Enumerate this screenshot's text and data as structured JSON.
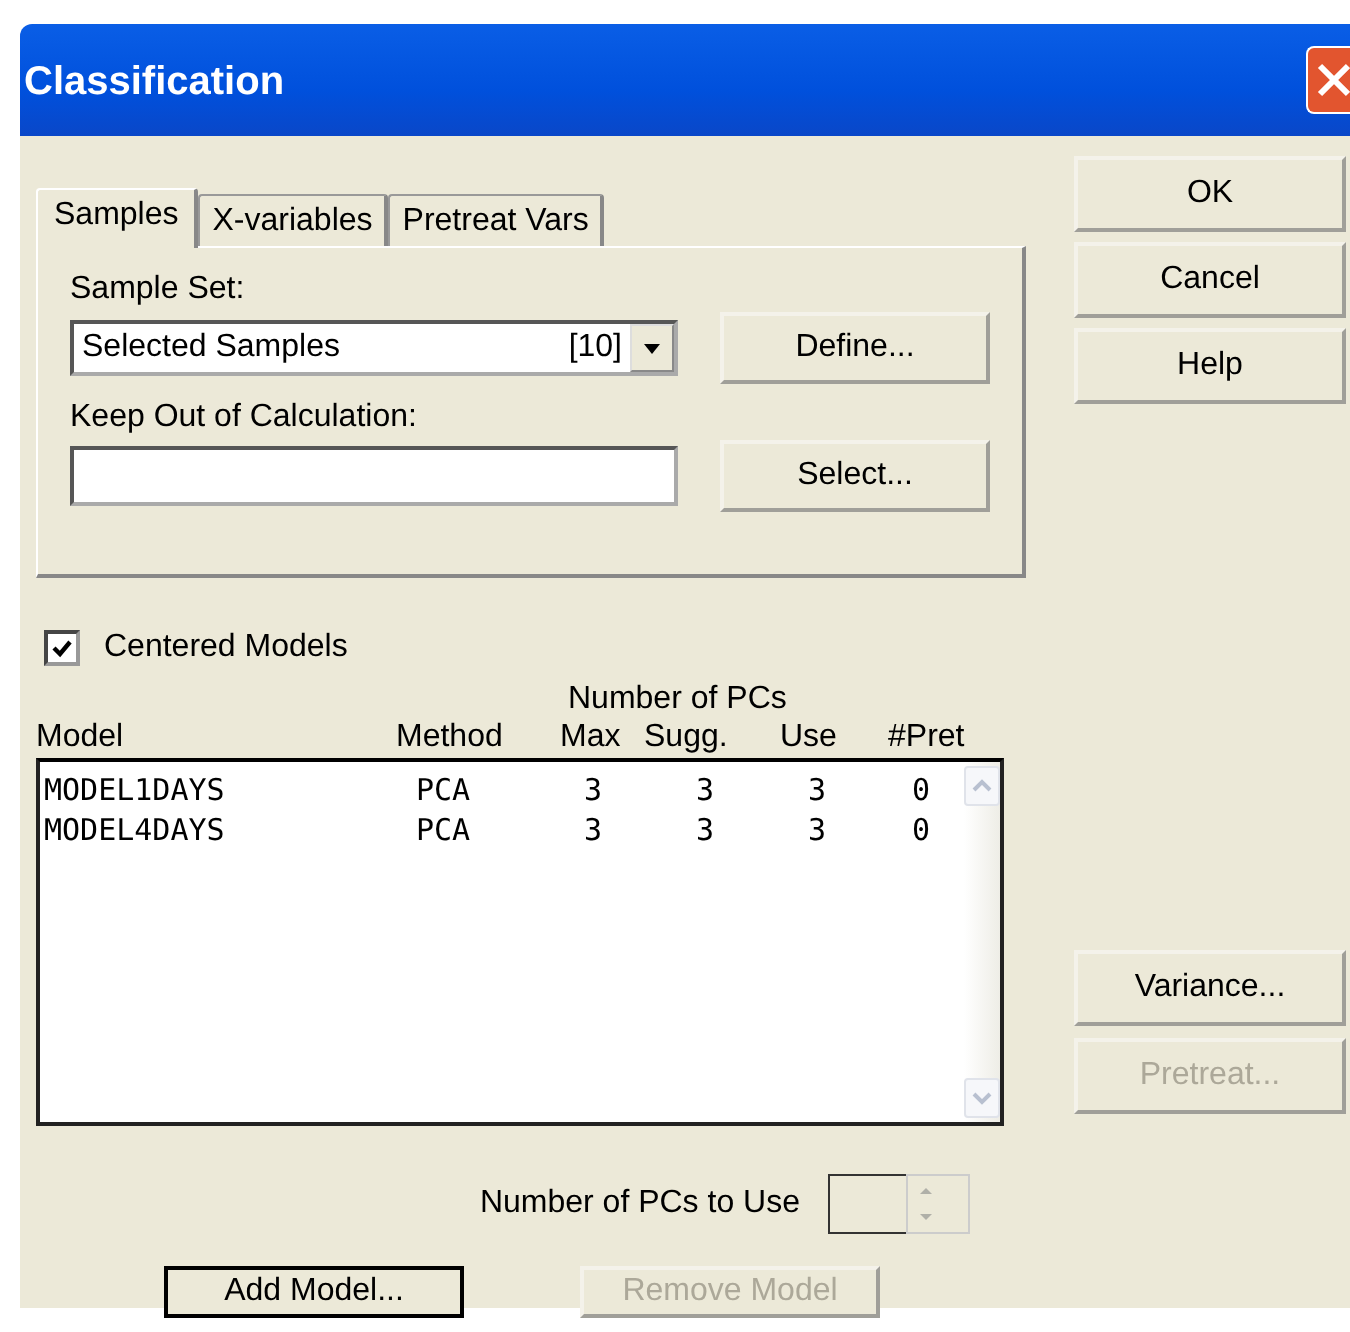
{
  "window": {
    "title": "Classification"
  },
  "tabs": [
    {
      "label": "Samples",
      "selected": true
    },
    {
      "label": "X-variables",
      "selected": false
    },
    {
      "label": "Pretreat Vars",
      "selected": false
    }
  ],
  "sample_set": {
    "label": "Sample Set:",
    "value": "Selected Samples",
    "count": "[10]"
  },
  "define_button": "Define...",
  "keep_out": {
    "label": "Keep Out of Calculation:"
  },
  "select_button": "Select...",
  "centered_models": {
    "label": "Centered Models",
    "checked": true
  },
  "table": {
    "group_header": "Number of PCs",
    "columns": [
      "Model",
      "Method",
      "Max",
      "Sugg.",
      "Use",
      "#Pret"
    ],
    "rows": [
      [
        "MODEL1DAYS",
        "PCA",
        "3",
        "3",
        "3",
        "0"
      ],
      [
        "MODEL4DAYS",
        "PCA",
        "3",
        "3",
        "3",
        "0"
      ]
    ]
  },
  "side_buttons_top": [
    {
      "label": "OK",
      "disabled": false
    },
    {
      "label": "Cancel",
      "disabled": false
    },
    {
      "label": "Help",
      "disabled": false
    }
  ],
  "side_buttons_bottom": [
    {
      "label": "Variance...",
      "disabled": false
    },
    {
      "label": "Pretreat...",
      "disabled": true
    }
  ],
  "pcs_to_use": {
    "label": "Number of PCs to Use"
  },
  "bottom_buttons": [
    {
      "label": "Add Model...",
      "disabled": false
    },
    {
      "label": "Remove Model",
      "disabled": true
    }
  ]
}
